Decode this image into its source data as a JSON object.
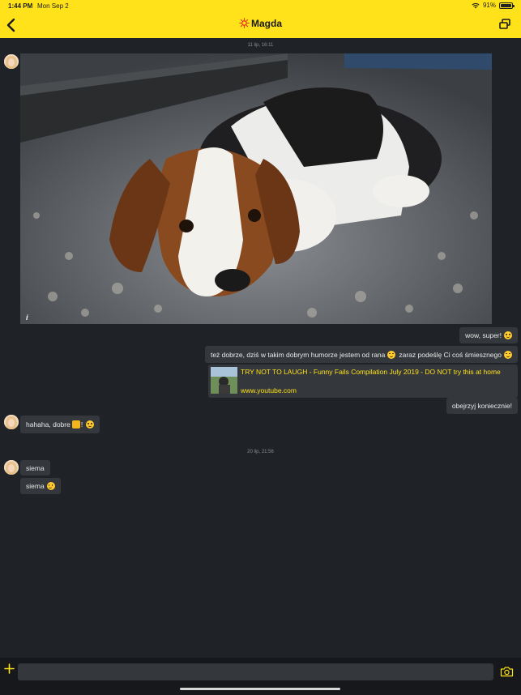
{
  "status": {
    "time": "1:44 PM",
    "date": "Mon Sep 2",
    "battery": "91%"
  },
  "header": {
    "contact_name": "Magda"
  },
  "date_separators": [
    "11 lip, 16:11",
    "20 lip, 21:56"
  ],
  "messages": {
    "m1": "wow, super!",
    "m2": "też dobrze, dziś w takim dobrym humorze jestem od rana",
    "m2b": "zaraz podeślę Ci coś śmiesznego",
    "m3": "obejrzyj koniecznie!",
    "m4": "hahaha, dobre",
    "m5": "siema",
    "m6": "siema"
  },
  "link_preview": {
    "title": "TRY NOT TO LAUGH - Funny Fails Compilation July 2019 - DO NOT try this at home",
    "url": "www.youtube.com"
  },
  "photo_info_label": "i",
  "composer": {
    "placeholder": ""
  },
  "colors": {
    "accent": "#ffe21a",
    "background": "#1f2226",
    "bubble": "#34373c"
  }
}
